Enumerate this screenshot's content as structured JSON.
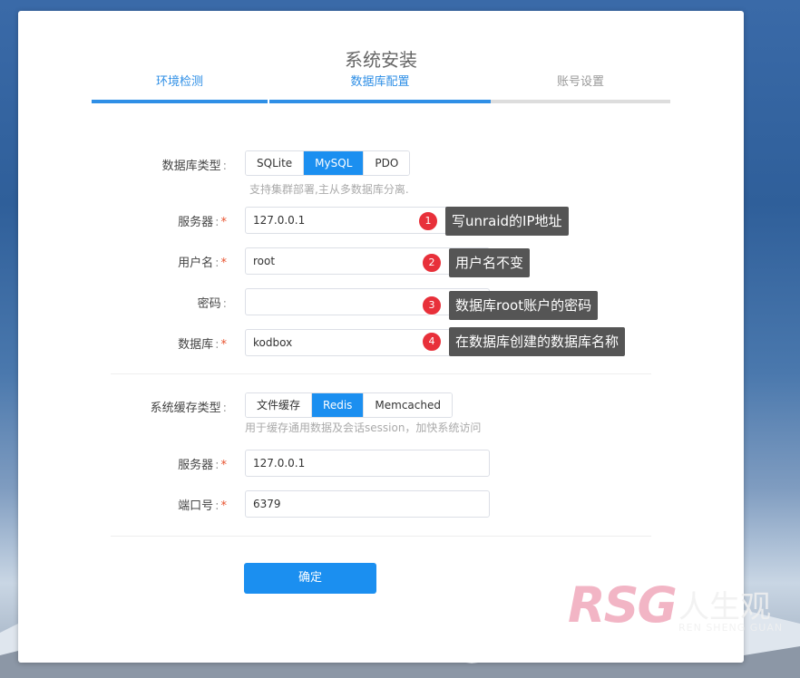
{
  "page": {
    "title": "系统安装"
  },
  "steps": [
    {
      "label": "环境检测",
      "state": "done"
    },
    {
      "label": "数据库配置",
      "state": "active"
    },
    {
      "label": "账号设置",
      "state": "pending"
    }
  ],
  "db": {
    "type_label": "数据库类型",
    "type_options": [
      "SQLite",
      "MySQL",
      "PDO"
    ],
    "type_selected": "MySQL",
    "type_hint": "支持集群部署,主从多数据库分离.",
    "server_label": "服务器",
    "server_value": "127.0.0.1",
    "user_label": "用户名",
    "user_value": "root",
    "password_label": "密码",
    "password_value": "",
    "name_label": "数据库",
    "name_value": "kodbox"
  },
  "cache": {
    "type_label": "系统缓存类型",
    "type_options": [
      "文件缓存",
      "Redis",
      "Memcached"
    ],
    "type_selected": "Redis",
    "type_hint": "用于缓存通用数据及会话session，加快系统访问",
    "server_label": "服务器",
    "server_value": "127.0.0.1",
    "port_label": "端口号",
    "port_value": "6379"
  },
  "separator": ":",
  "required_mark": "*",
  "submit_label": "确定",
  "annotations": [
    {
      "num": "1",
      "text": "写unraid的IP地址"
    },
    {
      "num": "2",
      "text": "用户名不变"
    },
    {
      "num": "3",
      "text": "数据库root账户的密码"
    },
    {
      "num": "4",
      "text": "在数据库创建的数据库名称"
    }
  ],
  "watermark": {
    "logo": "RSG",
    "cn": "人生观",
    "py": "REN SHENG GUAN"
  },
  "colors": {
    "accent": "#1b8ff0",
    "required": "#e8532f",
    "badge": "#e8303a",
    "tooltip": "#555555"
  }
}
